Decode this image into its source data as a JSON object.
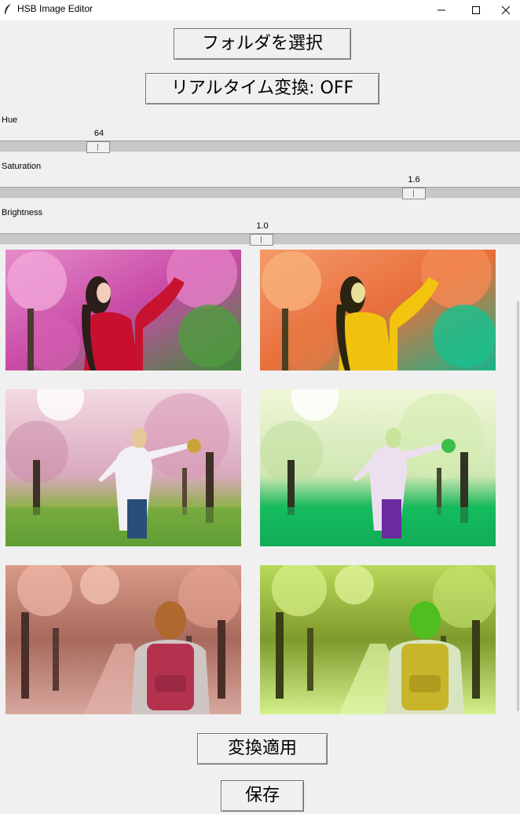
{
  "window": {
    "title": "HSB Image Editor",
    "icon": "feather-icon"
  },
  "buttons": {
    "select_folder": "フォルダを選択",
    "realtime_toggle": "リアルタイム変換: OFF",
    "apply": "変換適用",
    "save": "保存"
  },
  "sliders": {
    "hue": {
      "label": "Hue",
      "value": "64",
      "min": 0,
      "max": 360
    },
    "saturation": {
      "label": "Saturation",
      "value": "1.6",
      "min": 0,
      "max": 2
    },
    "brightness": {
      "label": "Brightness",
      "value": "1.0",
      "min": 0,
      "max": 2
    }
  },
  "images": [
    {
      "row": 1,
      "variant": "original",
      "scene": "woman-red-shirt-pink-blossoms"
    },
    {
      "row": 1,
      "variant": "converted",
      "scene": "woman-yellow-shirt-orange-blossoms"
    },
    {
      "row": 2,
      "variant": "original",
      "scene": "woman-white-coat-pink-park"
    },
    {
      "row": 2,
      "variant": "converted",
      "scene": "woman-white-coat-green-park"
    },
    {
      "row": 3,
      "variant": "original",
      "scene": "girl-pink-backpack-pink-path"
    },
    {
      "row": 3,
      "variant": "converted",
      "scene": "girl-yellow-backpack-green-path"
    }
  ],
  "colors": {
    "window_bg": "#f0f0f0",
    "trough": "#c7c7c7"
  }
}
